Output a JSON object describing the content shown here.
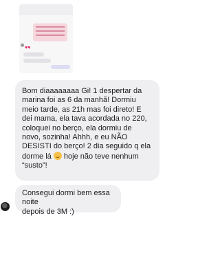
{
  "messages": [
    {
      "text_before_emoji": "Bom diaaaaaaaa Gi! 1 despertar da\nmarina foi as 6 da manhã! Dormiu\nmeio tarde, as 21h mas foi direto! E\ndei mama, ela tava acordada no 220,\ncoloquei no berço, ela dormiu de\nnovo, sozinha! Ahhh, e eu NÃO\nDESISTI do berço! 2 dia seguido q ela\ndorme lá ",
      "emoji": "grimacing-face-emoji",
      "text_after_emoji": " hoje não teve nenhum\n“susto”!"
    },
    {
      "text": "Consegui dormi bem essa noite\ndepois de 3M :)"
    }
  ]
}
